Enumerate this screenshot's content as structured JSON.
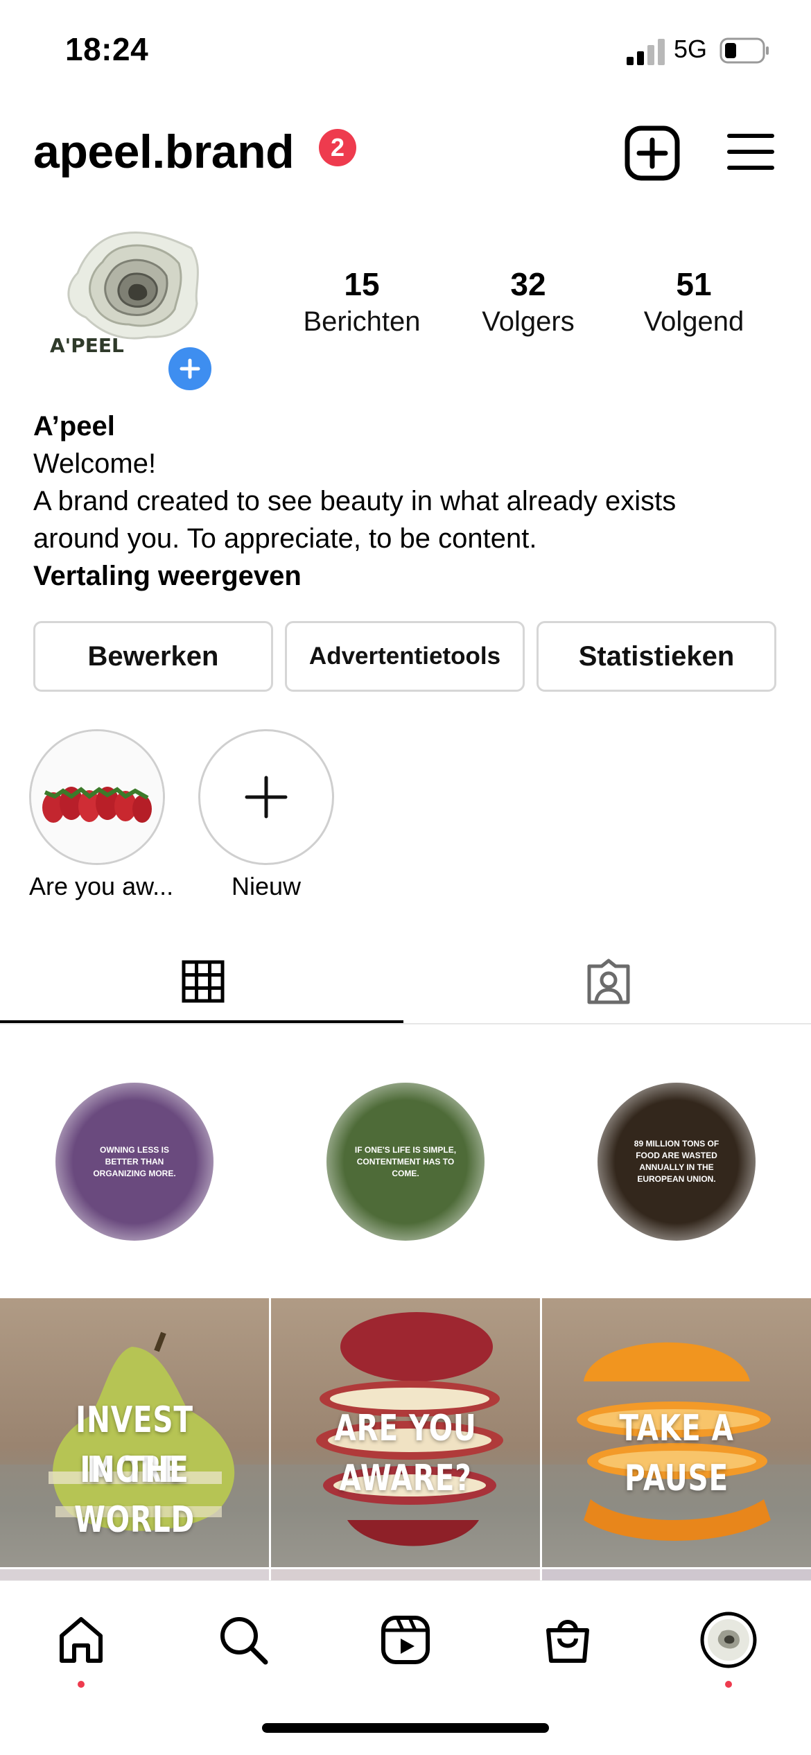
{
  "status_bar": {
    "time": "18:24",
    "network": "5G",
    "signal_icon": "signal-icon",
    "battery_icon": "battery-icon"
  },
  "header": {
    "username": "apeel.brand",
    "notification_count": "2",
    "badge_color": "#ee3b4e",
    "create_icon": "plus-square-icon",
    "menu_icon": "hamburger-menu-icon"
  },
  "profile": {
    "avatar_logo_text": "A'PEEL",
    "stats": [
      {
        "value": "15",
        "label": "Berichten"
      },
      {
        "value": "32",
        "label": "Volgers"
      },
      {
        "value": "51",
        "label": "Volgend"
      }
    ],
    "name": "A’peel",
    "bio_lines": [
      "Welcome!",
      "A brand created to see beauty in what already exists",
      "around you. To appreciate, to be content."
    ],
    "translate_label": "Vertaling weergeven"
  },
  "actions": {
    "edit": "Bewerken",
    "ad_tools": "Advertentietools",
    "insights": "Statistieken"
  },
  "highlights": [
    {
      "label": "Are you aw...",
      "icon": "strawberries-thumbnail"
    },
    {
      "label": "Nieuw",
      "icon": "plus-icon"
    }
  ],
  "tabs": [
    {
      "name": "grid",
      "icon": "grid-icon",
      "active": true
    },
    {
      "name": "tagged",
      "icon": "tagged-user-icon",
      "active": false
    }
  ],
  "posts": [
    {
      "type": "quote",
      "color": "#6a4a7e",
      "text": "OWNING LESS IS BETTER THAN ORGANIZING MORE."
    },
    {
      "type": "quote",
      "color": "#4e6b38",
      "text": "IF ONE'S LIFE IS SIMPLE, CONTENTMENT HAS TO COME."
    },
    {
      "type": "quote",
      "color": "#33271c",
      "text": "89 MILLION TONS OF FOOD ARE WASTED ANNUALLY IN THE EUROPEAN UNION."
    },
    {
      "type": "photo",
      "fruit": "pear",
      "lines": [
        "INVEST MORE",
        "IN THE",
        "WORLD"
      ]
    },
    {
      "type": "photo",
      "fruit": "apple",
      "lines": [
        "ARE YOU",
        "AWARE?"
      ]
    },
    {
      "type": "photo",
      "fruit": "orange",
      "lines": [
        "TAKE A",
        "PAUSE"
      ]
    }
  ],
  "bottom_nav": [
    {
      "name": "home",
      "icon": "home-icon",
      "has_dot": true
    },
    {
      "name": "search",
      "icon": "search-icon",
      "has_dot": false
    },
    {
      "name": "reels",
      "icon": "reels-icon",
      "has_dot": false
    },
    {
      "name": "shop",
      "icon": "shopping-bag-icon",
      "has_dot": false
    },
    {
      "name": "profile",
      "icon": "profile-avatar-icon",
      "has_dot": true
    }
  ],
  "colors": {
    "accent_blue": "#3e8ef0",
    "notification_red": "#ee3b4e"
  }
}
